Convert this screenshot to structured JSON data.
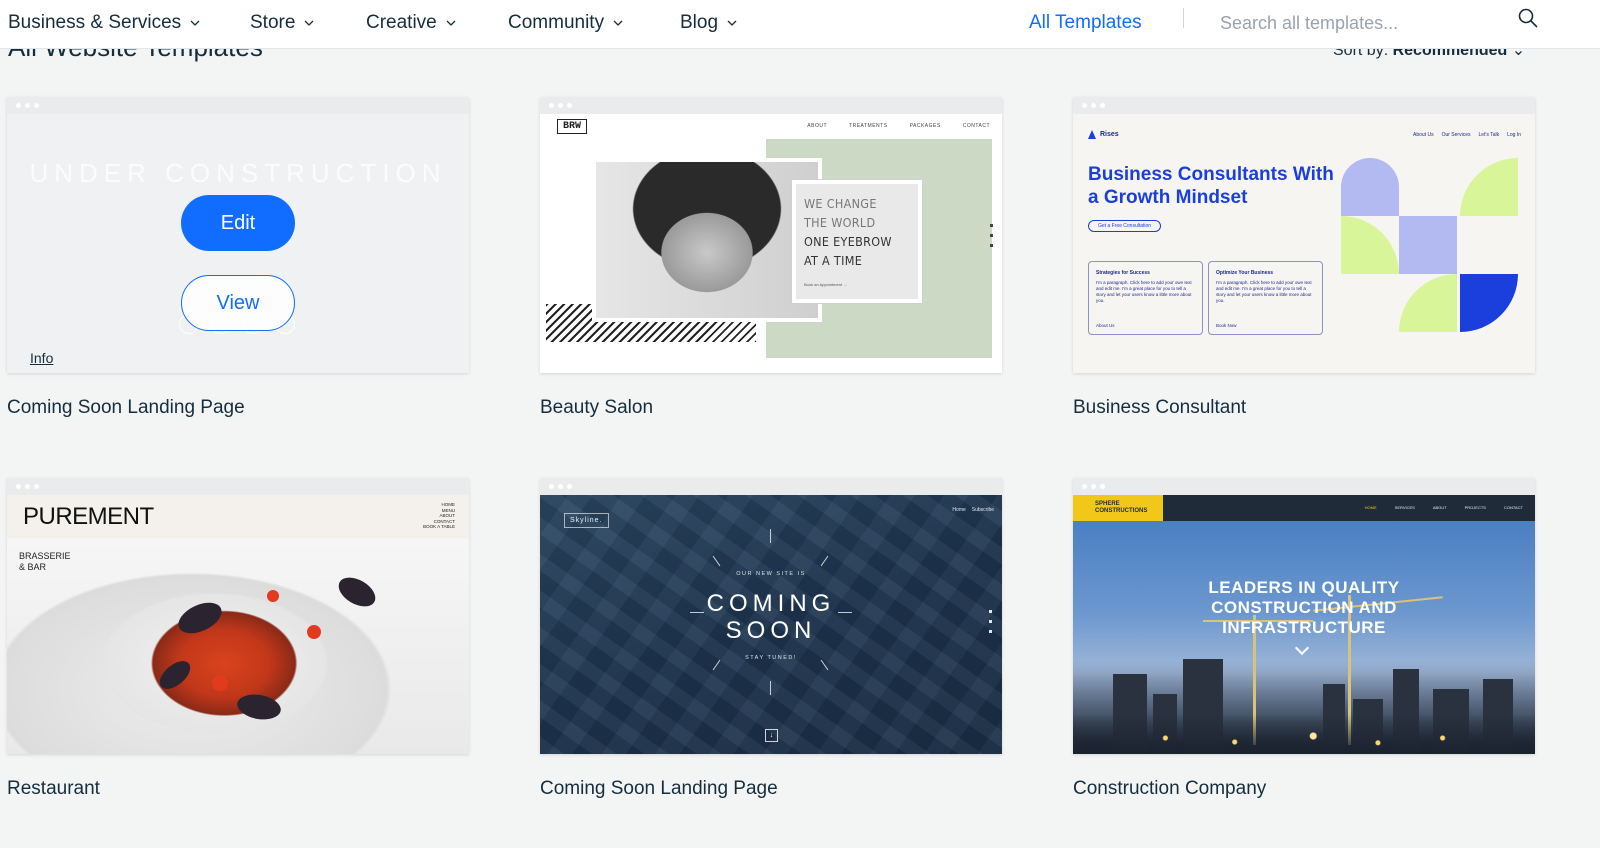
{
  "nav": {
    "items": [
      {
        "label": "Business & Services"
      },
      {
        "label": "Store"
      },
      {
        "label": "Creative"
      },
      {
        "label": "Community"
      },
      {
        "label": "Blog"
      }
    ],
    "all_templates": "All Templates",
    "search_placeholder": "Search all templates...",
    "accent_color": "#116dff"
  },
  "page": {
    "title": "All Website Templates",
    "sort_label": "Sort by:",
    "sort_value": "Recommended"
  },
  "hover_card": {
    "edit_label": "Edit",
    "view_label": "View",
    "info_label": "Info"
  },
  "templates": [
    {
      "name": "Coming Soon Landing Page",
      "preview": {
        "ghost_text": "UNDER CONSTRUCTION"
      }
    },
    {
      "name": "Beauty Salon",
      "preview": {
        "logo": "BRW",
        "menu": [
          "ABOUT",
          "TREATMENTS",
          "PACKAGES",
          "CONTACT"
        ],
        "quote_lines": [
          "WE CHANGE",
          "THE WORLD",
          "ONE EYEBROW",
          "AT A TIME"
        ],
        "book": "Book an Appointment →"
      }
    },
    {
      "name": "Business Consultant",
      "preview": {
        "logo": "Rises",
        "menu": [
          "About Us",
          "Our Services",
          "Let's Talk",
          "Log In"
        ],
        "headline": "Business Consultants With a Growth Mindset",
        "cta": "Get a Free Consultation",
        "boxes": [
          {
            "title": "Strategies for Success",
            "text": "I'm a paragraph. Click here to add your own text and edit me. I'm a great place for you to tell a story and let your users know a little more about you.",
            "link": "About Us"
          },
          {
            "title": "Optimize Your Business",
            "text": "I'm a paragraph. Click here to add your own text and edit me. I'm a great place for you to tell a story and let your users know a little more about you.",
            "link": "Book Now"
          }
        ],
        "shape_colors": [
          "#b3baf2",
          "#d9f59a",
          "#1b3fdc"
        ]
      }
    },
    {
      "name": "Restaurant",
      "preview": {
        "brand": "PUREMENT",
        "sub": "BRASSERIE & BAR",
        "menu": [
          "HOME",
          "MENU",
          "ABOUT",
          "CONTACT",
          "BOOK A TABLE"
        ]
      }
    },
    {
      "name": "Coming Soon Landing Page",
      "preview": {
        "logo": "Skyline.",
        "menu": [
          "Home",
          "Subscribe"
        ],
        "kicker": "OUR NEW SITE IS",
        "big_line1": "COMING",
        "big_line2": "SOON",
        "tagline": "STAY TUNED!"
      }
    },
    {
      "name": "Construction Company",
      "preview": {
        "logo": "SPHERE CONSTRUCTIONS",
        "menu": [
          "HOME",
          "SERVICES",
          "ABOUT",
          "PROJECTS",
          "CONTACT"
        ],
        "headline": "LEADERS IN QUALITY CONSTRUCTION AND INFRASTRUCTURE",
        "accent_color": "#f1c81a"
      }
    }
  ]
}
